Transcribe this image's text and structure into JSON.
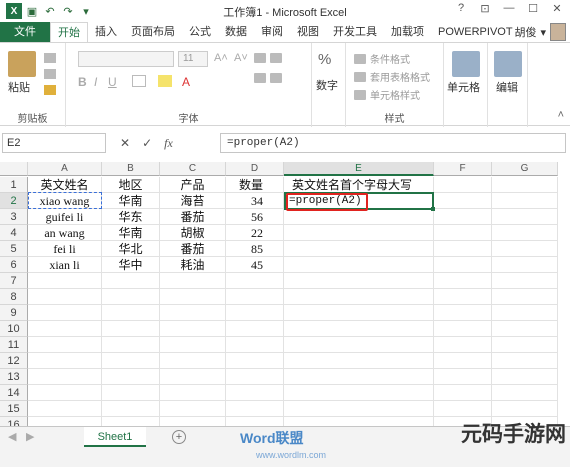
{
  "window": {
    "title": "工作簿1 - Microsoft Excel"
  },
  "tabs": [
    "文件",
    "开始",
    "插入",
    "页面布局",
    "公式",
    "数据",
    "审阅",
    "视图",
    "开发工具",
    "加载项",
    "POWERPIVOT"
  ],
  "active_tab": "开始",
  "user": {
    "name": "胡俊"
  },
  "ribbon": {
    "clipboard": {
      "paste_label": "粘贴",
      "group_label": "剪贴板"
    },
    "font": {
      "group_label": "字体",
      "size": "11"
    },
    "number": {
      "icon": "%",
      "label": "数字"
    },
    "styles": {
      "items": [
        "条件格式",
        "套用表格格式",
        "单元格样式"
      ],
      "group_label": "样式"
    },
    "cells": {
      "label": "单元格"
    },
    "editing": {
      "label": "编辑"
    }
  },
  "formula_bar": {
    "name_box": "E2",
    "formula": "=proper(A2)",
    "cancel": "✕",
    "enter": "✓",
    "fx": "fx"
  },
  "grid": {
    "columns": [
      "A",
      "B",
      "C",
      "D",
      "E",
      "F",
      "G"
    ],
    "rows": [
      "1",
      "2",
      "3",
      "4",
      "5",
      "6",
      "7",
      "8",
      "9",
      "10",
      "11",
      "12",
      "13",
      "14",
      "15",
      "16"
    ],
    "header_row": [
      "英文姓名",
      "地区",
      "产品",
      "数量",
      "英文姓名首个字母大写"
    ],
    "data": [
      [
        "xiao wang",
        "华南",
        "海苔",
        "34"
      ],
      [
        "guifei li",
        "华东",
        "番茄",
        "56"
      ],
      [
        "an wang",
        "华南",
        "胡椒",
        "22"
      ],
      [
        "fei li",
        "华北",
        "番茄",
        "85"
      ],
      [
        "xian li",
        "华中",
        "耗油",
        "45"
      ]
    ],
    "editing_cell": {
      "ref": "E2",
      "text": "=proper(A2)"
    }
  },
  "sheets": {
    "active": "Sheet1",
    "add": "+"
  },
  "watermark": {
    "text": "Word联盟",
    "url": "www.wordlm.com",
    "corner": "元码手游网"
  },
  "colors": {
    "accent": "#217346",
    "highlight": "#e1231f"
  }
}
